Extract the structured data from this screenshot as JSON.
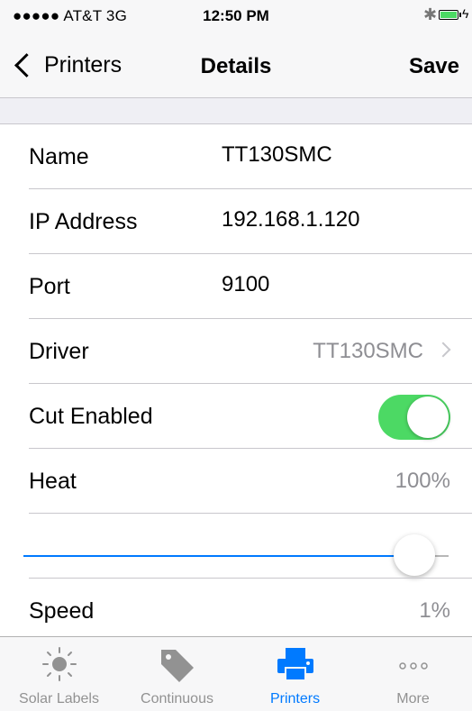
{
  "status_bar": {
    "carrier": "●●●●● AT&T  3G",
    "time": "12:50 PM"
  },
  "nav": {
    "back_label": "Printers",
    "title": "Details",
    "save_label": "Save"
  },
  "rows": {
    "name": {
      "label": "Name",
      "value": "TT130SMC"
    },
    "ip": {
      "label": "IP Address",
      "value": "192.168.1.120"
    },
    "port": {
      "label": "Port",
      "value": "9100"
    },
    "driver": {
      "label": "Driver",
      "value": "TT130SMC"
    },
    "cut": {
      "label": "Cut Enabled",
      "enabled": true
    },
    "heat": {
      "label": "Heat",
      "value": "100%",
      "slider_fraction": 0.92
    },
    "speed": {
      "label": "Speed",
      "value": "1%"
    }
  },
  "tabs": [
    {
      "label": "Solar Labels",
      "icon": "sun-icon",
      "active": false
    },
    {
      "label": "Continuous",
      "icon": "tag-icon",
      "active": false
    },
    {
      "label": "Printers",
      "icon": "printer-icon",
      "active": true
    },
    {
      "label": "More",
      "icon": "more-dots-icon",
      "active": false
    }
  ],
  "colors": {
    "accent": "#007aff",
    "toggle_on": "#4cd964",
    "secondary_text": "#8e8e93"
  }
}
